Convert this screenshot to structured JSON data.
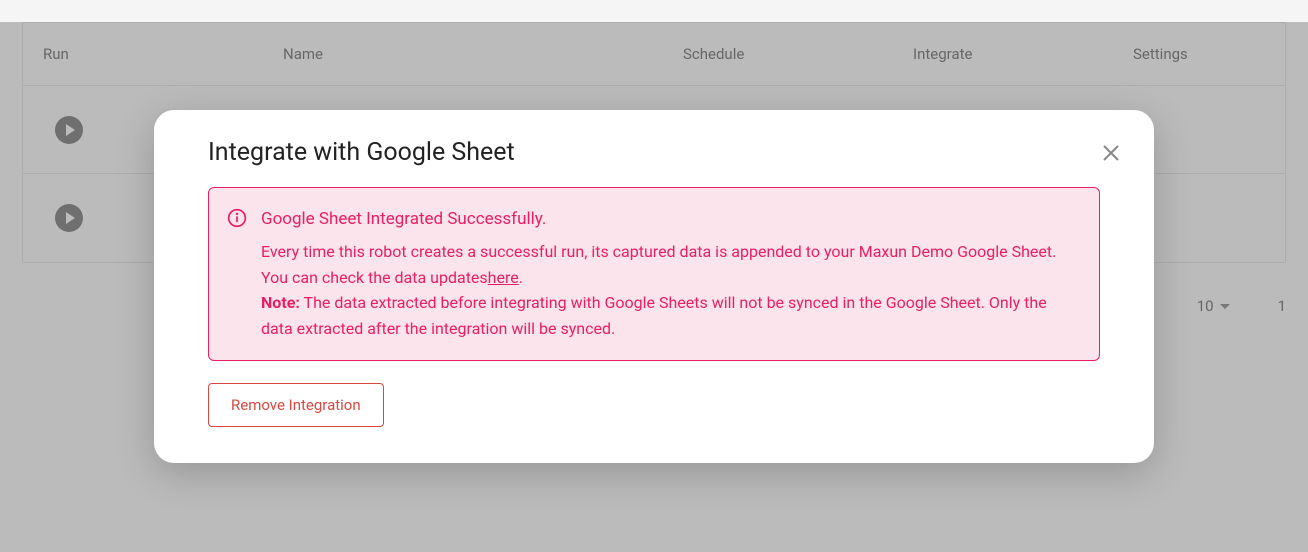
{
  "table": {
    "headers": {
      "run": "Run",
      "name": "Name",
      "schedule": "Schedule",
      "integrate": "Integrate",
      "settings": "Settings"
    }
  },
  "pagination": {
    "perPage": "10",
    "total": "1"
  },
  "modal": {
    "title": "Integrate with Google Sheet",
    "alert": {
      "title": "Google Sheet Integrated Successfully.",
      "body1": "Every time this robot creates a successful run, its captured data is appended to your Maxun Demo Google Sheet. You can check the data updates",
      "linkText": "here",
      "body1End": ".",
      "noteLabel": "Note:",
      "noteText": " The data extracted before integrating with Google Sheets will not be synced in the Google Sheet. Only the data extracted after the integration will be synced."
    },
    "removeButton": "Remove Integration"
  }
}
